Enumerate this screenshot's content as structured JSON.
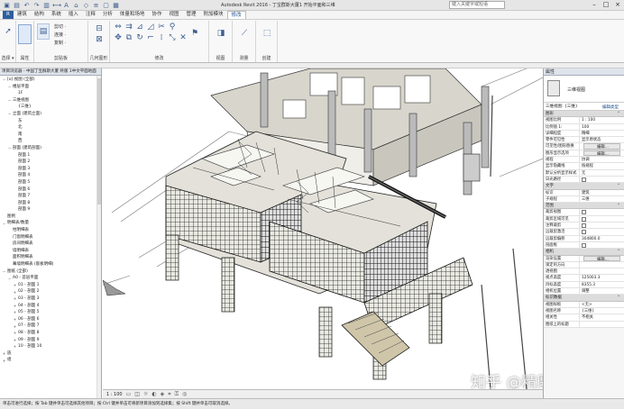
{
  "app": {
    "title": "Autodesk Revit 2016 - 丁宝群斯大厦1 开始平面和三维",
    "search_placeholder": "键入关键字或短语"
  },
  "quick_access_icons": [
    "open-icon",
    "save-icon",
    "undo-icon",
    "redo-icon",
    "print-icon",
    "measure-icon",
    "text-icon",
    "3d-icon",
    "section-icon",
    "thin-lines-icon",
    "close-hidden-icon",
    "switch-window-icon"
  ],
  "tabs": [
    "建筑",
    "结构",
    "系统",
    "插入",
    "注释",
    "分析",
    "体量和场地",
    "协作",
    "视图",
    "管理",
    "附加模块",
    "修改"
  ],
  "active_tab": "修改",
  "file_tab": "R",
  "ribbon": {
    "groups": [
      {
        "label": "选择 ▾"
      },
      {
        "label": "属性"
      },
      {
        "label": "剪贴板"
      },
      {
        "label": "几何图形"
      },
      {
        "label": "修改"
      },
      {
        "label": "视图"
      },
      {
        "label": "测量"
      },
      {
        "label": "创建"
      }
    ],
    "small_labels": [
      "剪切 ·",
      "连接 ·",
      "粘贴",
      "复制 ·",
      "匹配 ·",
      "修改 ·"
    ]
  },
  "project_browser": {
    "title": "项目浏览器 - 中国丁宝群斯大厦 终版 1中文平面地面",
    "items": [
      {
        "indent": 0,
        "toggle": "−",
        "text": "[o] 视图 (全部)"
      },
      {
        "indent": 1,
        "toggle": "−",
        "text": "楼层平面"
      },
      {
        "indent": 2,
        "toggle": "",
        "text": "1F"
      },
      {
        "indent": 1,
        "toggle": "−",
        "text": "三维视图"
      },
      {
        "indent": 2,
        "toggle": "",
        "text": "{三维}"
      },
      {
        "indent": 1,
        "toggle": "−",
        "text": "立面 (建筑立面)"
      },
      {
        "indent": 2,
        "toggle": "",
        "text": "东"
      },
      {
        "indent": 2,
        "toggle": "",
        "text": "北"
      },
      {
        "indent": 2,
        "toggle": "",
        "text": "南"
      },
      {
        "indent": 2,
        "toggle": "",
        "text": "西"
      },
      {
        "indent": 1,
        "toggle": "−",
        "text": "剖面 (建筑剖面)"
      },
      {
        "indent": 2,
        "toggle": "",
        "text": "剖面 1"
      },
      {
        "indent": 2,
        "toggle": "",
        "text": "剖面 2"
      },
      {
        "indent": 2,
        "toggle": "",
        "text": "剖面 3"
      },
      {
        "indent": 2,
        "toggle": "",
        "text": "剖面 4"
      },
      {
        "indent": 2,
        "toggle": "",
        "text": "剖面 5"
      },
      {
        "indent": 2,
        "toggle": "",
        "text": "剖面 6"
      },
      {
        "indent": 2,
        "toggle": "",
        "text": "剖面 7"
      },
      {
        "indent": 2,
        "toggle": "",
        "text": "剖面 8"
      },
      {
        "indent": 2,
        "toggle": "",
        "text": "剖面 9"
      },
      {
        "indent": 0,
        "toggle": "",
        "text": "图例"
      },
      {
        "indent": 0,
        "toggle": "−",
        "text": "明细表/数量"
      },
      {
        "indent": 1,
        "toggle": "",
        "text": "柱明细表"
      },
      {
        "indent": 1,
        "toggle": "",
        "text": "门窗明细表"
      },
      {
        "indent": 1,
        "toggle": "",
        "text": "房间明细表"
      },
      {
        "indent": 1,
        "toggle": "",
        "text": "墙明细表"
      },
      {
        "indent": 1,
        "toggle": "",
        "text": "面积明细表"
      },
      {
        "indent": 1,
        "toggle": "",
        "text": "幕墙明细表 (嵌板明细)"
      },
      {
        "indent": 0,
        "toggle": "−",
        "text": "图纸 (全部)"
      },
      {
        "indent": 1,
        "toggle": "−",
        "text": "A0 - 首层平面"
      },
      {
        "indent": 2,
        "toggle": "+",
        "text": "01 - 剖面 1"
      },
      {
        "indent": 2,
        "toggle": "+",
        "text": "02 - 剖面 2"
      },
      {
        "indent": 2,
        "toggle": "+",
        "text": "03 - 剖面 3"
      },
      {
        "indent": 2,
        "toggle": "+",
        "text": "04 - 剖面 4"
      },
      {
        "indent": 2,
        "toggle": "+",
        "text": "05 - 剖面 5"
      },
      {
        "indent": 2,
        "toggle": "+",
        "text": "06 - 剖面 6"
      },
      {
        "indent": 2,
        "toggle": "+",
        "text": "07 - 剖面 7"
      },
      {
        "indent": 2,
        "toggle": "+",
        "text": "08 - 剖面 8"
      },
      {
        "indent": 2,
        "toggle": "+",
        "text": "09 - 剖面 9"
      },
      {
        "indent": 2,
        "toggle": "+",
        "text": "10 - 剖面 10"
      },
      {
        "indent": 0,
        "toggle": "+",
        "text": "族"
      },
      {
        "indent": 0,
        "toggle": "+",
        "text": "组"
      }
    ]
  },
  "properties": {
    "title": "属性",
    "type_name": "三维视图",
    "filter_label": "三维视图: {三维}",
    "edit_type": "编辑类型",
    "groups": [
      {
        "title": "图形",
        "rows": [
          {
            "k": "视图比例",
            "v": "1 : 100"
          },
          {
            "k": "比例值 1:",
            "v": "100"
          },
          {
            "k": "详细程度",
            "v": "精细"
          },
          {
            "k": "零件可见性",
            "v": "显示原状态"
          },
          {
            "k": "可见性/图形替换",
            "v": "编辑...",
            "btn": true
          },
          {
            "k": "图形显示选项",
            "v": "编辑...",
            "btn": true
          },
          {
            "k": "规程",
            "v": "协调"
          },
          {
            "k": "显示隐藏线",
            "v": "按规程"
          },
          {
            "k": "默认分析显示样式",
            "v": "无"
          },
          {
            "k": "日光路径",
            "v": "",
            "cb": true
          }
        ]
      },
      {
        "title": "文字",
        "rows": [
          {
            "k": "标识",
            "v": "建筑"
          },
          {
            "k": "子规程",
            "v": "三维"
          }
        ]
      },
      {
        "title": "范围",
        "rows": [
          {
            "k": "裁剪视图",
            "v": "",
            "cb": true
          },
          {
            "k": "裁剪区域可见",
            "v": "",
            "cb": true
          },
          {
            "k": "注释裁剪",
            "v": "",
            "cb": true
          },
          {
            "k": "远裁剪激活",
            "v": "",
            "cb": true
          },
          {
            "k": "远裁剪偏移",
            "v": "304800.0"
          },
          {
            "k": "剖面框",
            "v": "",
            "cb": true
          }
        ]
      },
      {
        "title": "相机",
        "rows": [
          {
            "k": "渲染设置",
            "v": "编辑...",
            "btn": true
          },
          {
            "k": "锁定的方向",
            "v": ""
          },
          {
            "k": "透视图",
            "v": ""
          },
          {
            "k": "视点高度",
            "v": "125003.3"
          },
          {
            "k": "目标高度",
            "v": "8355.3"
          },
          {
            "k": "相机位置",
            "v": "调整"
          }
        ]
      },
      {
        "title": "标识数据",
        "rows": [
          {
            "k": "视图样板",
            "v": "<无>"
          },
          {
            "k": "视图名称",
            "v": "{三维}"
          },
          {
            "k": "相关性",
            "v": "不相关"
          },
          {
            "k": "图纸上的标题",
            "v": ""
          }
        ]
      }
    ]
  },
  "statusbar": {
    "text": "单击可进行选择；按 Tab 键并单击可选择其他项目；按 Ctrl 键并单击可将新项目添加到选择集；按 Shift 键并单击可取消选择。"
  },
  "view_control": {
    "scale": "1 : 100"
  },
  "watermark": "知乎 @精雕细作"
}
